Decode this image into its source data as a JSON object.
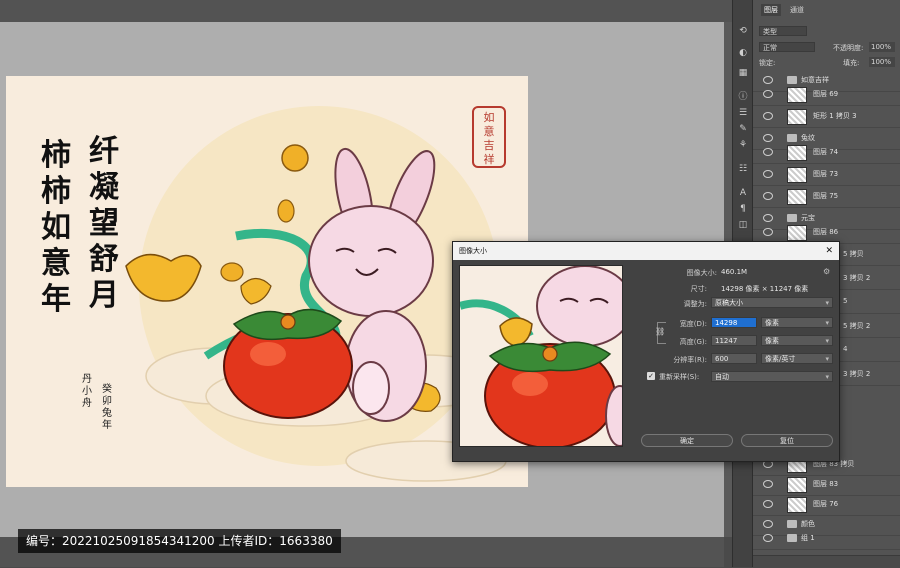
{
  "layers_panel": {
    "tabs": [
      "图层",
      "通道"
    ],
    "filter_placeholder": "类型",
    "blend_mode": "正常",
    "opacity_label": "不透明度:",
    "opacity_value": "100%",
    "lock_label": "锁定:",
    "fill_label": "填充:",
    "fill_value": "100%",
    "rows": [
      {
        "name": "如意吉祥",
        "kind": "group"
      },
      {
        "name": "图层 69",
        "kind": "layer"
      },
      {
        "name": "矩形 1 拷贝 3",
        "kind": "layer"
      },
      {
        "name": "兔纹",
        "kind": "group"
      },
      {
        "name": "图层 74",
        "kind": "layer"
      },
      {
        "name": "图层 73",
        "kind": "layer"
      },
      {
        "name": "图层 75",
        "kind": "layer"
      },
      {
        "name": "元宝",
        "kind": "group"
      },
      {
        "name": "图层 86",
        "kind": "layer"
      }
    ],
    "partial_rows": [
      "5 拷贝",
      "3 拷贝 2",
      "5",
      "5 拷贝 2",
      "4",
      "3 拷贝 2"
    ],
    "bottom_rows": [
      {
        "name": "图层 83 拷贝",
        "kind": "layer"
      },
      {
        "name": "图层 83",
        "kind": "layer"
      },
      {
        "name": "图层 76",
        "kind": "layer"
      },
      {
        "name": "颜色",
        "kind": "group"
      },
      {
        "name": "组 1",
        "kind": "group"
      }
    ]
  },
  "canvas": {
    "col_right": [
      "纤",
      "凝",
      "望",
      "舒",
      "月"
    ],
    "col_left": [
      "柿",
      "柿",
      "如",
      "意",
      "年"
    ],
    "small_right": "癸卯兔年",
    "small_left": "丹小舟",
    "seal_text": [
      "如",
      "意",
      "吉",
      "祥"
    ]
  },
  "dialog": {
    "title": "图像大小",
    "image_size_label": "图像大小:",
    "image_size_value": "460.1M",
    "dimensions_label": "尺寸:",
    "dimensions_value": "14298 像素 × 11247 像素",
    "fit_label": "调整为:",
    "fit_value": "原稿大小",
    "width_label": "宽度(D):",
    "width_value": "14298",
    "width_unit": "像素",
    "height_label": "高度(G):",
    "height_value": "11247",
    "height_unit": "像素",
    "resolution_label": "分辨率(R):",
    "resolution_value": "600",
    "resolution_unit": "像素/英寸",
    "resample_label": "重新采样(S):",
    "resample_value": "自动",
    "ok_label": "确定",
    "cancel_label": "复位",
    "close_glyph": "✕"
  },
  "watermark": {
    "text": "编号：20221025091854341200 上传者ID：1663380"
  },
  "colors": {
    "persimmon": "#e2361c",
    "rabbit": "#f3cfdc",
    "ribbon": "#34b58a",
    "gold": "#f0b028"
  }
}
